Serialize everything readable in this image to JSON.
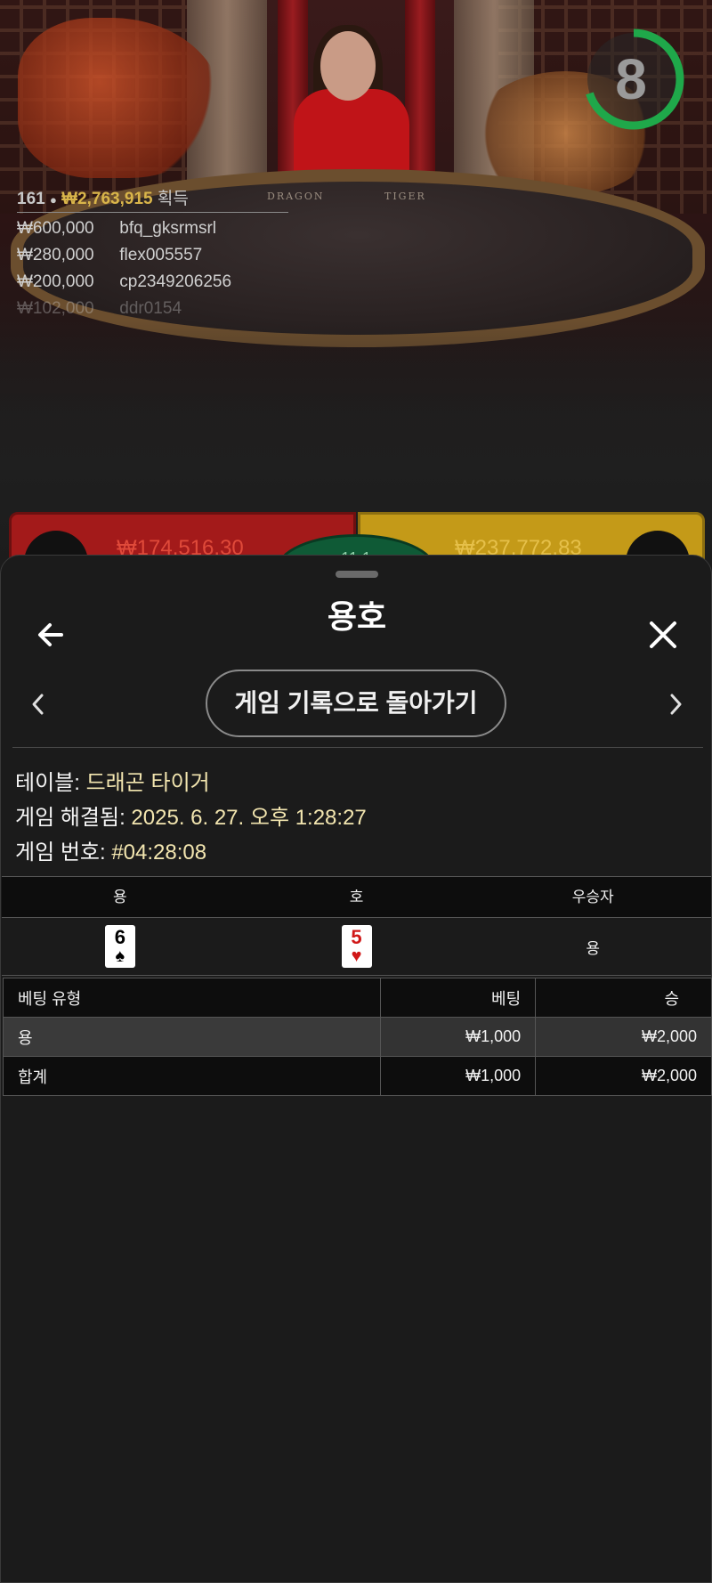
{
  "video": {
    "timer_value": "8",
    "timer_fraction": 0.7,
    "table_labels": {
      "dragon": "DRAGON",
      "tiger": "TIGER"
    },
    "winners": {
      "count": "161",
      "total": "₩2,763,915",
      "label": "획득",
      "rows": [
        {
          "amount": "₩600,000",
          "user": "bfq_gksrmsrl"
        },
        {
          "amount": "₩280,000",
          "user": "flex005557"
        },
        {
          "amount": "₩200,000",
          "user": "cp2349206256"
        },
        {
          "amount": "₩102,000",
          "user": "ddr0154"
        }
      ]
    },
    "bet_strip": {
      "dragon_total": "₩174,516.30",
      "tiger_total": "₩237,772.83",
      "tie_payout": "11:1"
    }
  },
  "sheet": {
    "title": "용호",
    "back_to_history": "게임 기록으로 돌아가기",
    "info": {
      "table_label": "테이블:",
      "table_value": "드래곤 타이거",
      "resolved_label": "게임 해결됨:",
      "resolved_value": "2025. 6. 27. 오후 1:28:27",
      "round_label": "게임 번호:",
      "round_value": "#04:28:08"
    },
    "result": {
      "headers": [
        "용",
        "호",
        "우승자"
      ],
      "dragon_card": {
        "rank": "6",
        "suit": "♠"
      },
      "tiger_card": {
        "rank": "5",
        "suit": "♥"
      },
      "winner": "용"
    },
    "bets": {
      "headers": [
        "베팅 유형",
        "베팅",
        "승"
      ],
      "rows": [
        {
          "type": "용",
          "bet": "₩1,000",
          "win": "₩2,000"
        }
      ],
      "total": {
        "type": "합계",
        "bet": "₩1,000",
        "win": "₩2,000"
      }
    }
  },
  "colors": {
    "accent_gold": "#d9b54a",
    "info_value": "#f3e6b0",
    "timer_green": "#1fa84a",
    "dragon_red": "#a31a1a",
    "tiger_gold": "#c49a18"
  }
}
